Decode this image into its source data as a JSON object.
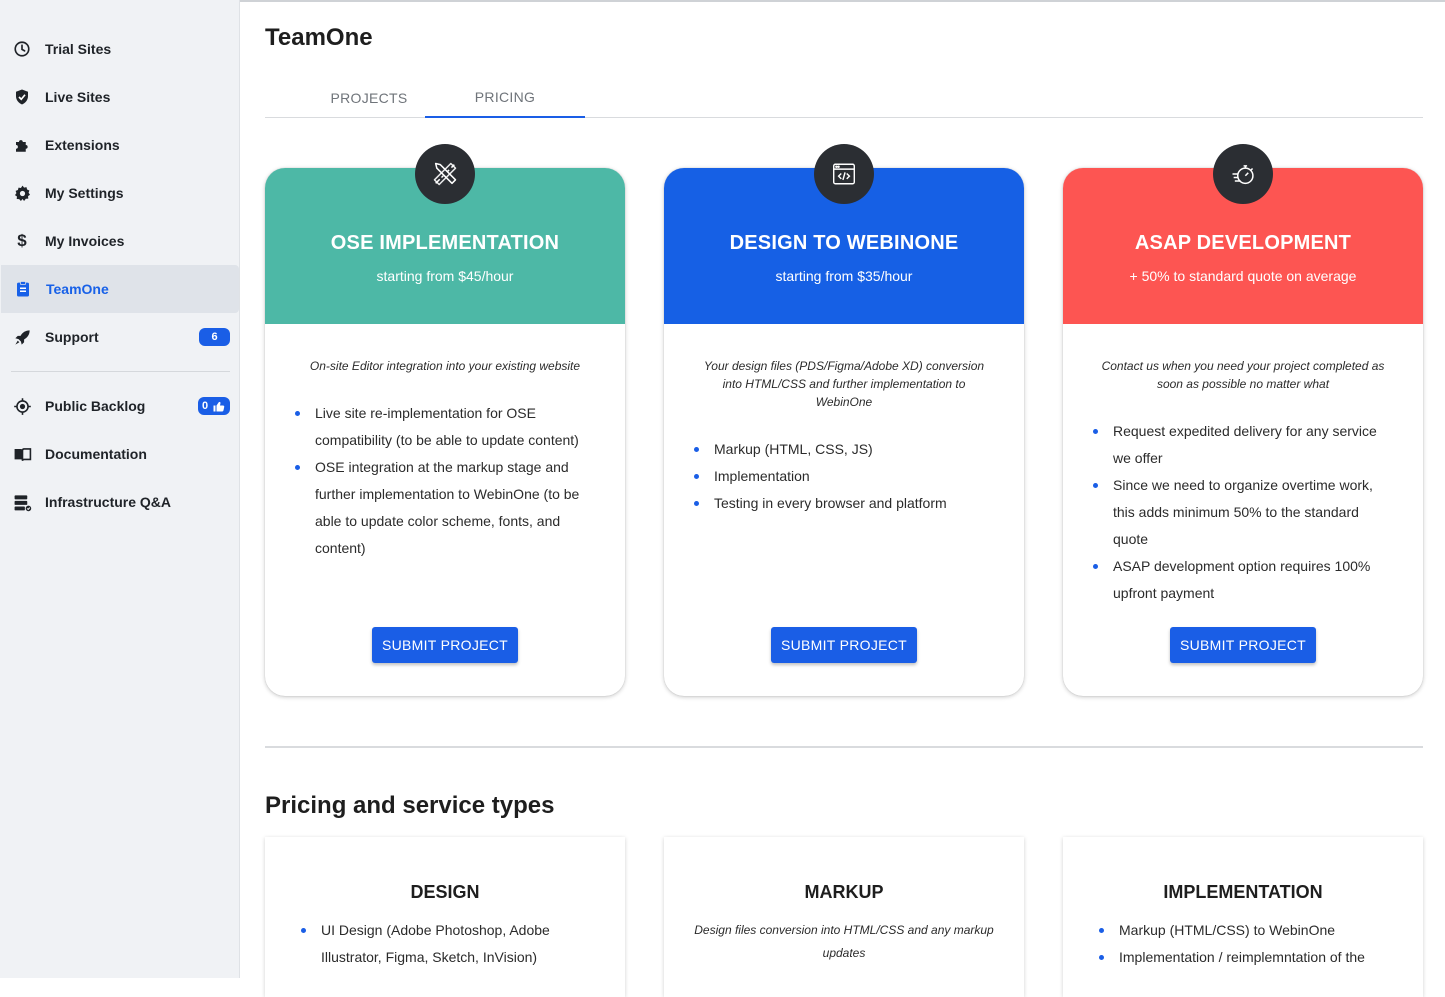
{
  "sidebar": {
    "items": [
      {
        "label": "Trial Sites",
        "icon": "clock-icon"
      },
      {
        "label": "Live Sites",
        "icon": "shield-check-icon"
      },
      {
        "label": "Extensions",
        "icon": "puzzle-icon"
      },
      {
        "label": "My Settings",
        "icon": "gear-icon"
      },
      {
        "label": "My Invoices",
        "icon": "dollar-icon"
      },
      {
        "label": "TeamOne",
        "icon": "clipboard-icon",
        "active": true
      },
      {
        "label": "Support",
        "icon": "rocket-icon",
        "badge": "6"
      },
      {
        "label": "Public Backlog",
        "icon": "target-icon",
        "badge": "0"
      },
      {
        "label": "Documentation",
        "icon": "book-icon"
      },
      {
        "label": "Infrastructure Q&A",
        "icon": "server-icon"
      }
    ]
  },
  "main": {
    "title": "TeamOne",
    "tabs": [
      {
        "label": "PROJECTS"
      },
      {
        "label": "PRICING",
        "active": true
      }
    ]
  },
  "pricing_cards": [
    {
      "title": "OSE IMPLEMENTATION",
      "subtitle": "starting from $45/hour",
      "color": "#4db8a6",
      "icon": "tools-icon",
      "description": "On-site Editor integration into your existing website",
      "features": [
        "Live site re-implementation for OSE compatibility (to be able to update content)",
        "OSE integration at the markup stage and further implementation to WebinOne (to be able to update color scheme, fonts, and content)"
      ],
      "button": "SUBMIT PROJECT"
    },
    {
      "title": "DESIGN TO WEBINONE",
      "subtitle": "starting from $35/hour",
      "color": "#1660e5",
      "icon": "code-window-icon",
      "description": "Your design files (PDS/Figma/Adobe XD) conversion into HTML/CSS and further implementation to WebinOne",
      "features": [
        "Markup (HTML, CSS, JS)",
        "Implementation",
        "Testing in every browser and platform"
      ],
      "button": "SUBMIT PROJECT"
    },
    {
      "title": "ASAP DEVELOPMENT",
      "subtitle": "+ 50% to standard quote on average",
      "color": "#fd5552",
      "icon": "stopwatch-icon",
      "description": "Contact us when you need your project completed as soon as possible no matter what",
      "features": [
        "Request expedited delivery for any service we offer",
        "Since we need to organize overtime work, this adds minimum 50% to the standard quote",
        "ASAP development option requires 100% upfront payment"
      ],
      "button": "SUBMIT PROJECT"
    }
  ],
  "service_section": {
    "title": "Pricing and service types",
    "cards": [
      {
        "title": "DESIGN",
        "features": [
          "UI Design (Adobe Photoshop, Adobe Illustrator, Figma, Sketch, InVision)"
        ]
      },
      {
        "title": "MARKUP",
        "description": "Design files conversion into HTML/CSS and any markup updates"
      },
      {
        "title": "IMPLEMENTATION",
        "features": [
          "Markup (HTML/CSS) to WebinOne",
          "Implementation / reimplemntation of the"
        ]
      }
    ]
  }
}
